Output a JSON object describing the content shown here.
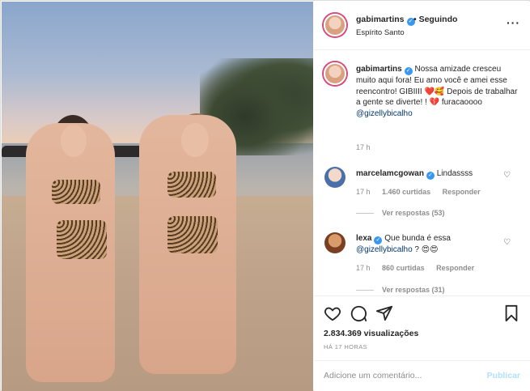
{
  "post": {
    "username": "gabimartins",
    "follow_status": "• Seguindo",
    "location": "Espírito Santo"
  },
  "caption": {
    "username": "gabimartins",
    "text": "Nossa amizade cresceu muito aqui fora! Eu amo você e amei esse reencontro! GIBIIII ❤️🥰 Depois de trabalhar a gente se diverte! ! 💔 furacaoooo",
    "mention": "@gizellybicalho",
    "time": "17 h"
  },
  "comments": [
    {
      "username": "marcelamcgowan",
      "text": "Lindassss",
      "time": "17 h",
      "likes": "1.460 curtidas",
      "reply": "Responder",
      "view_replies": "Ver respostas (53)"
    },
    {
      "username": "lexa",
      "text": "Que bunda é essa",
      "mention": "@gizellybicalho",
      "text_after": "? 😍😍",
      "time": "17 h",
      "likes": "860 curtidas",
      "reply": "Responder",
      "view_replies": "Ver respostas (31)"
    }
  ],
  "stats": {
    "views": "2.834.369 visualizações",
    "posted": "HÁ 17 HORAS"
  },
  "composer": {
    "placeholder": "Adicione um comentário...",
    "publish": "Publicar"
  },
  "icons": {
    "more": "more-options-icon",
    "like": "heart-icon",
    "comment": "comment-icon",
    "share": "share-icon",
    "save": "bookmark-icon",
    "verified": "verified-badge-icon"
  },
  "colors": {
    "verified": "#3897f0",
    "link": "#00376b",
    "muted": "#8e8e8e",
    "publish_disabled": "#b2dffc"
  }
}
